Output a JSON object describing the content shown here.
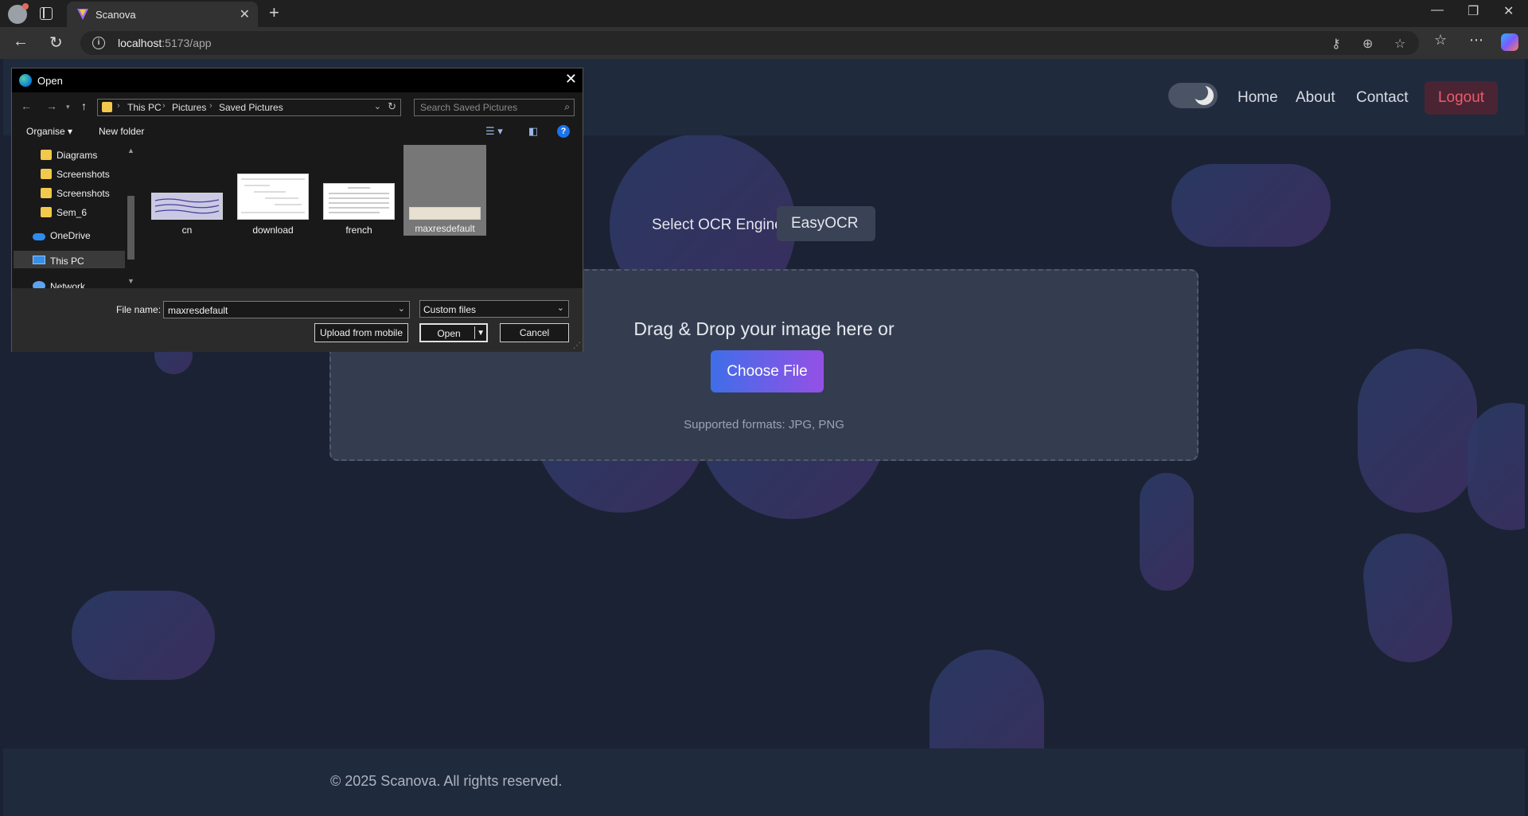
{
  "browser": {
    "tab_title": "Scanova",
    "url_host": "localhost",
    "url_rest": ":5173/app"
  },
  "navbar": {
    "links": [
      "Home",
      "About",
      "Contact"
    ],
    "logout": "Logout",
    "theme_toggle": "dark"
  },
  "main": {
    "ocr_label": "Select OCR Engine:",
    "ocr_engine": "EasyOCR",
    "dropzone_title": "Drag & Drop your image here or",
    "choose_file": "Choose File",
    "formats": "Supported formats: JPG, PNG"
  },
  "footer": {
    "copyright": "© 2025 Scanova. All rights reserved."
  },
  "dialog": {
    "title": "Open",
    "breadcrumb": [
      "This PC",
      "Pictures",
      "Saved Pictures"
    ],
    "search_placeholder": "Search Saved Pictures",
    "organise": "Organise",
    "new_folder": "New folder",
    "nav_items": [
      "Diagrams",
      "Screenshots",
      "Screenshots",
      "Sem_6",
      "OneDrive",
      "This PC",
      "Network"
    ],
    "selected_nav": "This PC",
    "files": [
      {
        "name": "cn",
        "selected": false
      },
      {
        "name": "download",
        "selected": false
      },
      {
        "name": "french",
        "selected": false
      },
      {
        "name": "maxresdefault",
        "selected": true
      }
    ],
    "file_name_label": "File name:",
    "file_name_value": "maxresdefault",
    "file_type": "Custom files",
    "upload_mobile": "Upload from mobile",
    "open": "Open",
    "cancel": "Cancel"
  }
}
